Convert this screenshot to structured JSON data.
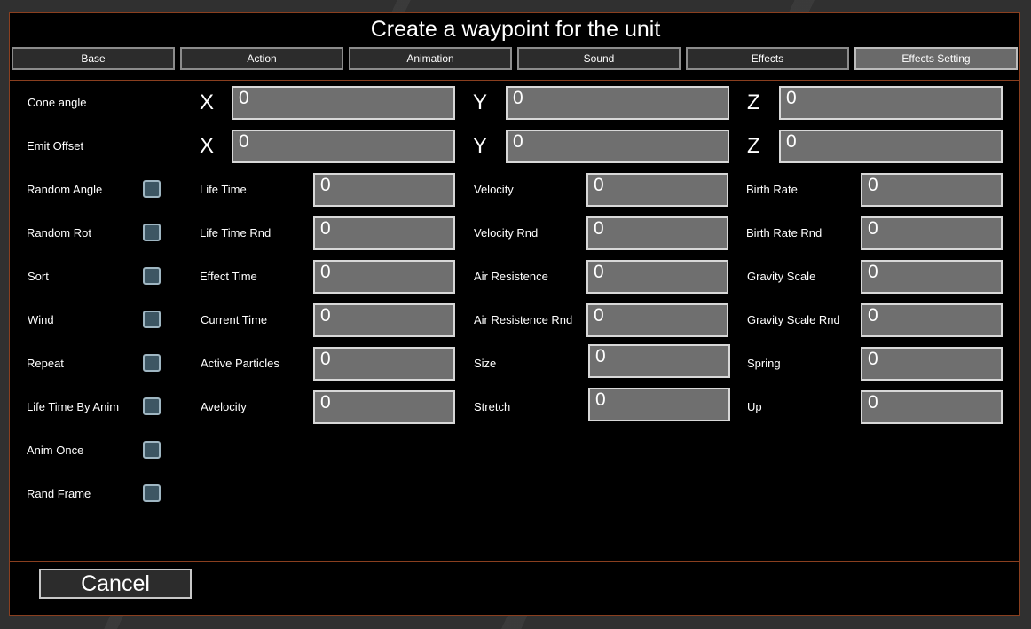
{
  "dialog": {
    "title": "Create a waypoint for the unit",
    "tabs": [
      "Base",
      "Action",
      "Animation",
      "Sound",
      "Effects",
      "Effects Setting"
    ],
    "active_tab": "Effects Setting",
    "cancel_label": "Cancel"
  },
  "vector_rows": [
    {
      "label": "Cone angle",
      "x_label": "X",
      "y_label": "Y",
      "z_label": "Z",
      "x": "0",
      "y": "0",
      "z": "0"
    },
    {
      "label": "Emit Offset",
      "x_label": "X",
      "y_label": "Y",
      "z_label": "Z",
      "x": "0",
      "y": "0",
      "z": "0"
    }
  ],
  "checkboxes": [
    {
      "label": "Random Angle",
      "checked": false
    },
    {
      "label": "Random Rot",
      "checked": false
    },
    {
      "label": "Sort",
      "checked": false
    },
    {
      "label": "Wind",
      "checked": false
    },
    {
      "label": "Repeat",
      "checked": false
    },
    {
      "label": "Life Time By Anim",
      "checked": false
    },
    {
      "label": "Anim Once",
      "checked": false
    },
    {
      "label": "Rand Frame",
      "checked": false
    }
  ],
  "col1_fields": [
    {
      "label": "Life Time",
      "value": "0"
    },
    {
      "label": "Life Time Rnd",
      "value": "0"
    },
    {
      "label": "Effect Time",
      "value": "0"
    },
    {
      "label": "Current Time",
      "value": "0"
    },
    {
      "label": "Active Particles",
      "value": "0"
    },
    {
      "label": "Avelocity",
      "value": "0"
    }
  ],
  "col2_fields": [
    {
      "label": "Velocity",
      "value": "0"
    },
    {
      "label": "Velocity Rnd",
      "value": "0"
    },
    {
      "label": "Air Resistence",
      "value": "0"
    },
    {
      "label": "Air Resistence Rnd",
      "value": "0"
    },
    {
      "label": "Size",
      "value": "0"
    },
    {
      "label": "Stretch",
      "value": "0"
    }
  ],
  "col3_fields": [
    {
      "label": "Birth Rate",
      "value": "0"
    },
    {
      "label": "Birth Rate Rnd",
      "value": "0"
    },
    {
      "label": "Gravity Scale",
      "value": "0"
    },
    {
      "label": "Gravity Scale Rnd",
      "value": "0"
    },
    {
      "label": "Spring",
      "value": "0"
    },
    {
      "label": "Up",
      "value": "0"
    }
  ]
}
